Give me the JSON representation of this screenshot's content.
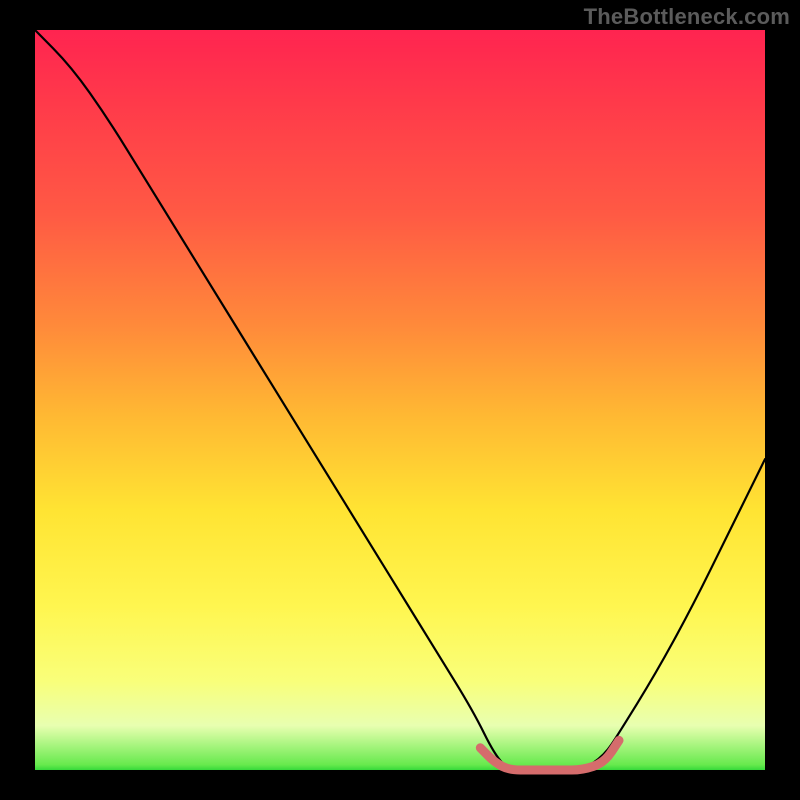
{
  "watermark": "TheBottleneck.com",
  "chart_data": {
    "type": "line",
    "title": "",
    "xlabel": "",
    "ylabel": "",
    "xlim": [
      0,
      100
    ],
    "ylim": [
      0,
      100
    ],
    "grid": false,
    "legend": false,
    "annotations": [],
    "series": [
      {
        "name": "curve",
        "color": "#000000",
        "x": [
          0,
          5,
          10,
          15,
          20,
          25,
          30,
          35,
          40,
          45,
          50,
          55,
          60,
          63,
          65,
          68,
          72,
          75,
          78,
          80,
          85,
          90,
          95,
          100
        ],
        "values": [
          100,
          95,
          88,
          80,
          72,
          64,
          56,
          48,
          40,
          32,
          24,
          16,
          8,
          2,
          0,
          0,
          0,
          0,
          2,
          5,
          13,
          22,
          32,
          42
        ]
      },
      {
        "name": "highlight",
        "color": "#d96a6a",
        "x": [
          61,
          63,
          65,
          68,
          72,
          75,
          78,
          80
        ],
        "values": [
          3,
          1,
          0,
          0,
          0,
          0,
          1,
          4
        ]
      }
    ],
    "gradient_stops": [
      {
        "pos": 0,
        "color": "#ff2450"
      },
      {
        "pos": 25,
        "color": "#ff5a44"
      },
      {
        "pos": 50,
        "color": "#ffb833"
      },
      {
        "pos": 78,
        "color": "#fff650"
      },
      {
        "pos": 94,
        "color": "#e8ffb0"
      },
      {
        "pos": 100,
        "color": "#36d93a"
      }
    ]
  }
}
